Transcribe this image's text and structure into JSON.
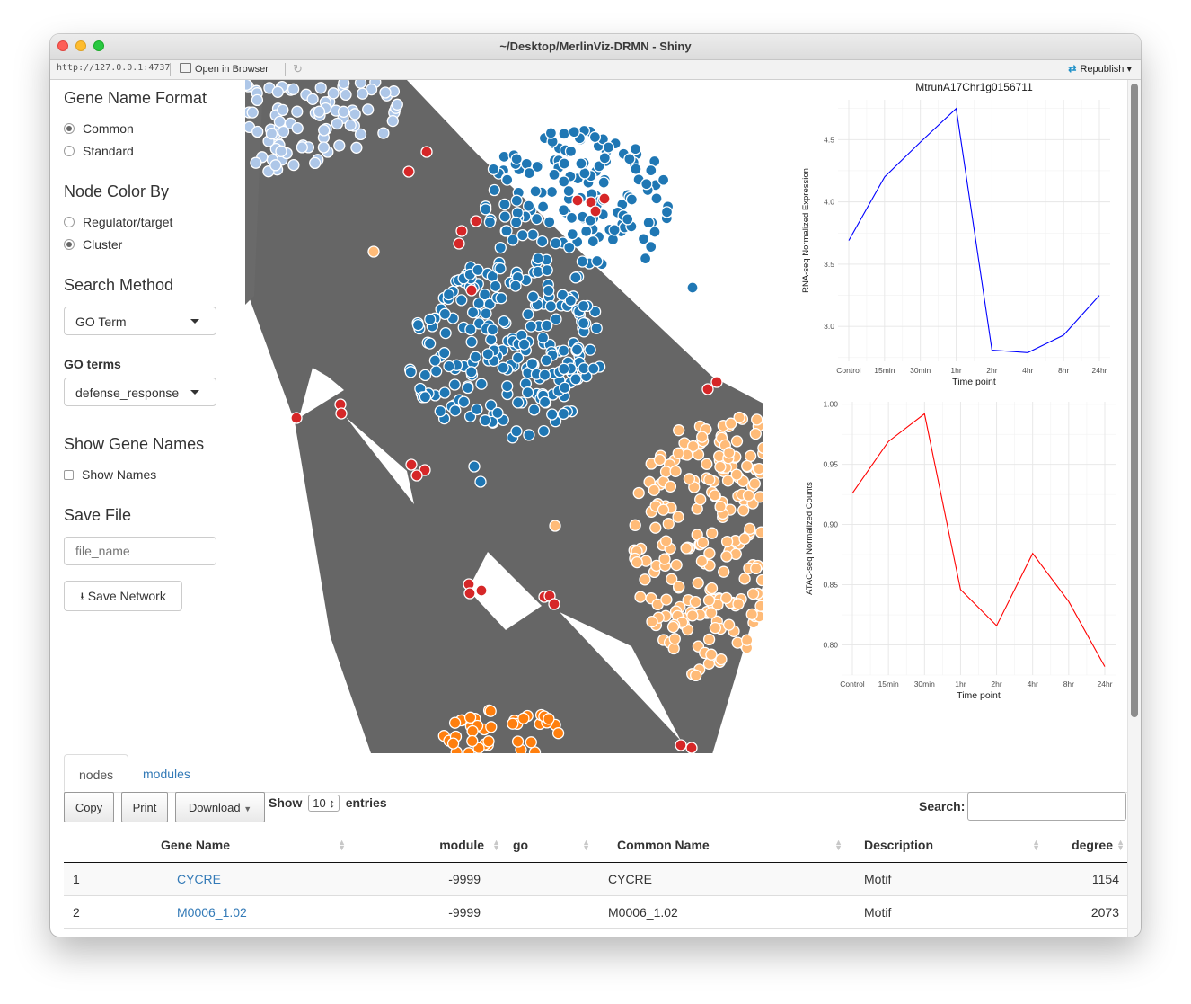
{
  "window": {
    "title": "~/Desktop/MerlinViz-DRMN - Shiny",
    "url": "http://127.0.0.1:4737",
    "open_browser_label": "Open in Browser",
    "republish_label": "Republish"
  },
  "sidebar": {
    "gene_name_format": {
      "heading": "Gene Name Format",
      "options": [
        "Common",
        "Standard"
      ],
      "selected": "Common"
    },
    "node_color_by": {
      "heading": "Node Color By",
      "options": [
        "Regulator/target",
        "Cluster"
      ],
      "selected": "Cluster"
    },
    "search_method": {
      "heading": "Search Method",
      "value": "GO Term"
    },
    "go_terms": {
      "label": "GO terms",
      "value": "defense_response"
    },
    "show_gene_names": {
      "heading": "Show Gene Names",
      "checkbox_label": "Show Names",
      "checked": false
    },
    "save_file": {
      "heading": "Save File",
      "placeholder": "file_name",
      "button_label": "Save Network"
    }
  },
  "network": {
    "background_color": "#666666",
    "cluster_colors": {
      "light_blue": "#aec7e8",
      "blue": "#1f77b4",
      "red": "#d62728",
      "light_orange": "#ffbb78",
      "orange": "#ff7f0e"
    }
  },
  "chart_data": [
    {
      "type": "line",
      "title": "MtrunA17Chr1g0156711",
      "xlabel": "Time point",
      "ylabel": "RNA-seq Normalized Expression",
      "categories": [
        "Control",
        "15min",
        "30min",
        "1hr",
        "2hr",
        "4hr",
        "8hr",
        "24hr"
      ],
      "series": [
        {
          "values": [
            3.69,
            4.2,
            4.48,
            4.75,
            2.81,
            2.79,
            2.93,
            3.25
          ],
          "color": "#0000ff"
        }
      ],
      "y_ticks": [
        "3.0",
        "3.5",
        "4.0",
        "4.5"
      ],
      "ylim": [
        2.72,
        4.82
      ],
      "grid": true
    },
    {
      "type": "line",
      "xlabel": "Time point",
      "ylabel": "ATAC-seq Normalized Counts",
      "categories": [
        "Control",
        "15min",
        "30min",
        "1hr",
        "2hr",
        "4hr",
        "8hr",
        "24hr"
      ],
      "series": [
        {
          "values": [
            0.926,
            0.969,
            0.992,
            0.846,
            0.816,
            0.876,
            0.836,
            0.782
          ],
          "color": "#ff0000"
        }
      ],
      "y_ticks": [
        "0.80",
        "0.85",
        "0.90",
        "0.95",
        "1.00"
      ],
      "ylim": [
        0.775,
        1.002
      ],
      "grid": true
    }
  ],
  "tabs": [
    "nodes",
    "modules"
  ],
  "active_tab": "nodes",
  "table": {
    "buttons": [
      "Copy",
      "Print",
      "Download"
    ],
    "show_label": "Show",
    "page_length": "10",
    "entries_label": "entries",
    "search_label": "Search:",
    "columns": [
      "",
      "Gene Name",
      "module",
      "go",
      "Common Name",
      "Description",
      "degree"
    ],
    "rows": [
      [
        "1",
        "CYCRE",
        "-9999",
        "",
        "CYCRE",
        "Motif",
        "1154"
      ],
      [
        "2",
        "M0006_1.02",
        "-9999",
        "",
        "M0006_1.02",
        "Motif",
        "2073"
      ]
    ]
  }
}
